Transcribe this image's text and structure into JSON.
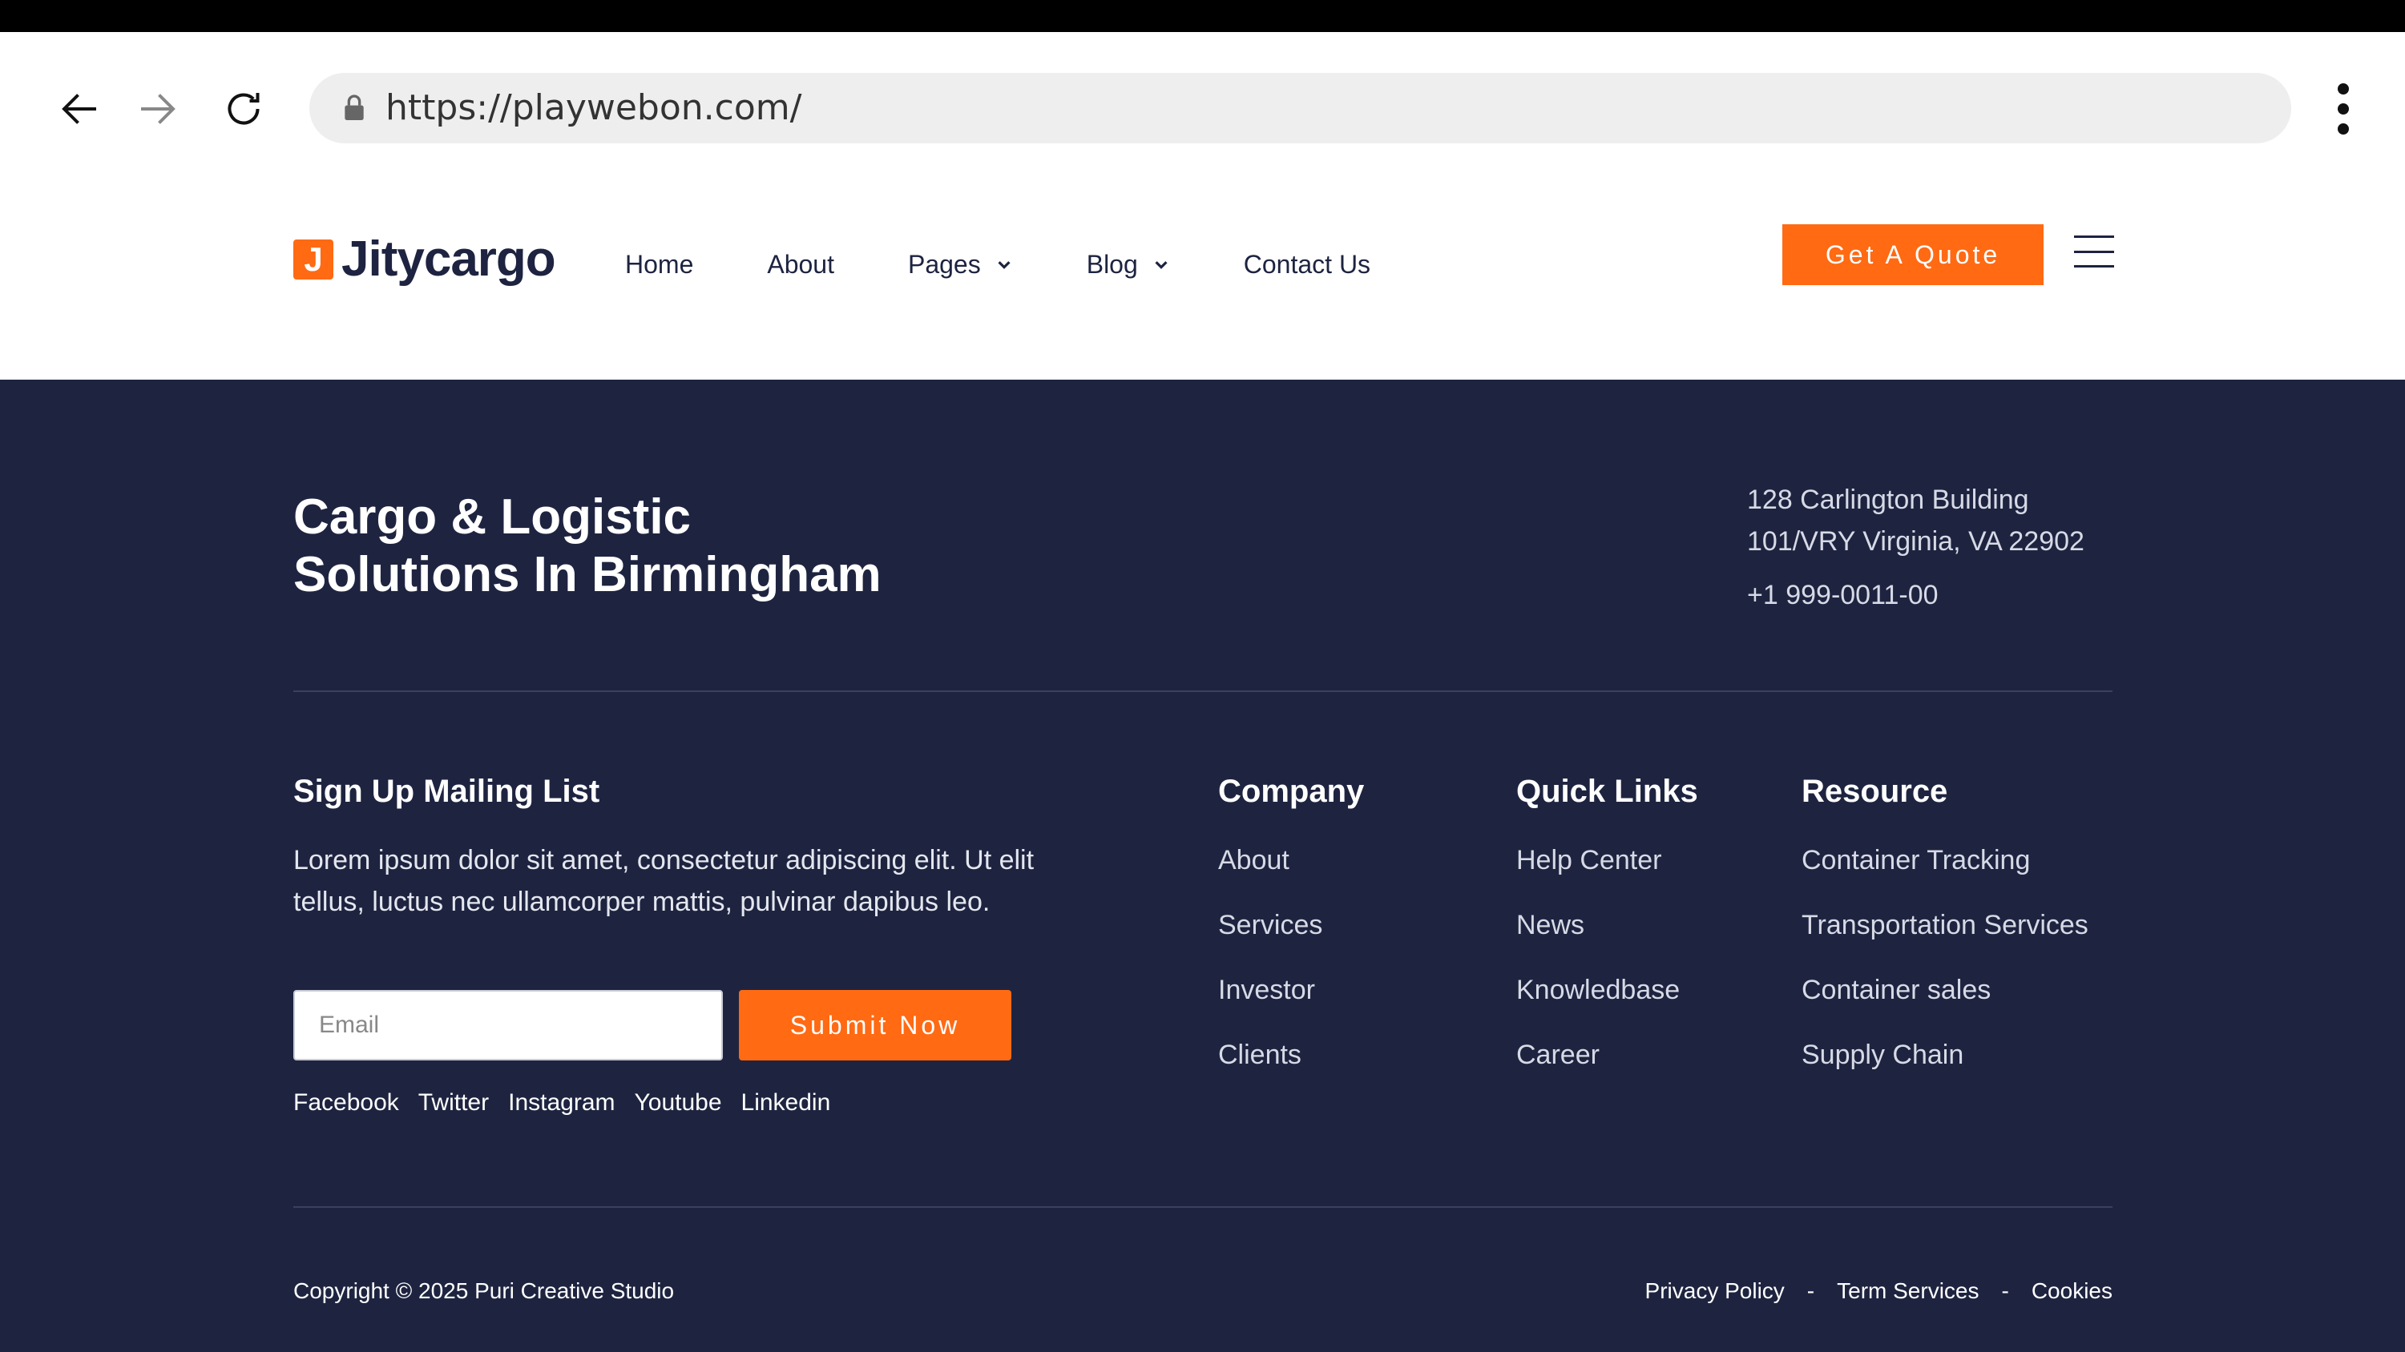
{
  "browser": {
    "url": "https://playwebon.com/"
  },
  "header": {
    "logo_mark": "J",
    "logo_text": "Jitycargo",
    "nav": [
      {
        "label": "Home"
      },
      {
        "label": "About"
      },
      {
        "label": "Pages"
      },
      {
        "label": "Blog"
      },
      {
        "label": "Contact Us"
      }
    ],
    "cta_label": "Get A Quote"
  },
  "footer": {
    "headline_line1": "Cargo & Logistic",
    "headline_line2": "Solutions In Birmingham",
    "address_line1": "128 Carlington Building",
    "address_line2": "101/VRY Virginia, VA 22902",
    "phone": "+1 999-0011-00",
    "signup": {
      "title": "Sign Up Mailing List",
      "text": "Lorem ipsum dolor sit amet, consectetur adipiscing elit. Ut elit tellus, luctus nec ullamcorper mattis, pulvinar dapibus leo.",
      "email_placeholder": "Email",
      "submit_label": "Submit Now"
    },
    "social": [
      "Facebook",
      "Twitter",
      "Instagram",
      "Youtube",
      "Linkedin"
    ],
    "columns": [
      {
        "title": "Company",
        "links": [
          "About",
          "Services",
          "Investor",
          "Clients"
        ]
      },
      {
        "title": "Quick Links",
        "links": [
          "Help Center",
          "News",
          "Knowledbase",
          "Career"
        ]
      },
      {
        "title": "Resource",
        "links": [
          "Container Tracking",
          "Transportation Services",
          "Container sales",
          "Supply Chain"
        ]
      }
    ],
    "copyright": "Copyright © 2025 Puri Creative Studio",
    "legal": {
      "privacy": "Privacy Policy",
      "separator": "-",
      "terms": "Term Services",
      "cookies": "Cookies"
    }
  },
  "colors": {
    "accent": "#ff6a13",
    "footer_bg": "#1e2440"
  }
}
